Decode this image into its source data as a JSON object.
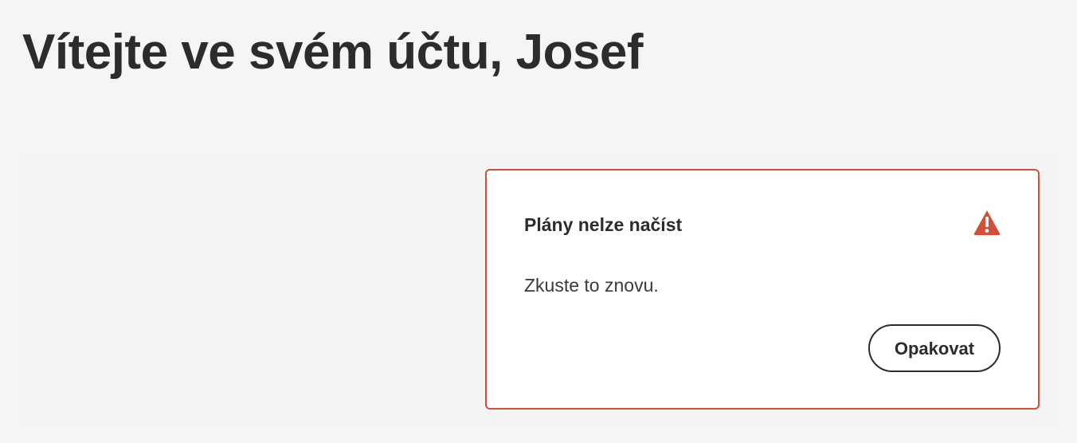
{
  "header": {
    "welcome_title": "Vítejte ve svém účtu, Josef"
  },
  "plans_error": {
    "title": "Plány nelze načíst",
    "message": "Zkuste to znovu.",
    "retry_label": "Opakovat",
    "icon": "warning-icon",
    "accent_color": "#d24f3a"
  },
  "colors": {
    "page_background": "#f5f5f5",
    "card_background": "#ffffff",
    "text": "#2c2c2c",
    "error_border": "#d24f3a"
  }
}
